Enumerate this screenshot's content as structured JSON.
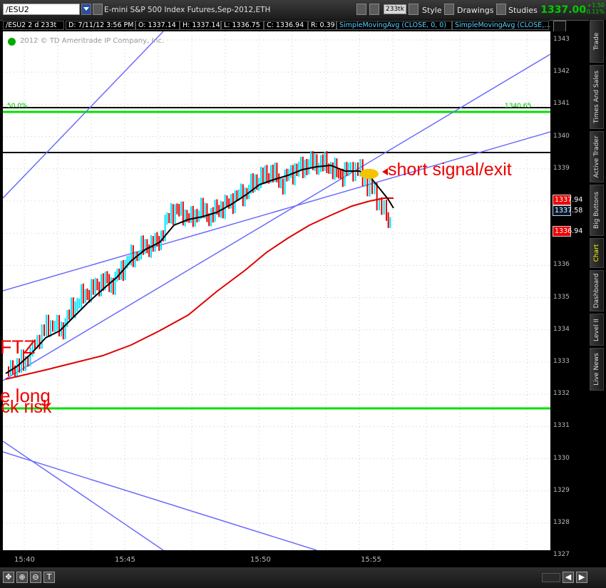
{
  "toolbar": {
    "symbol": "/ESU2",
    "description": "E-mini S&P 500 Index Futures,Sep-2012,ETH",
    "tick_badge": "233tk",
    "style_label": "Style",
    "drawings_label": "Drawings",
    "studies_label": "Studies",
    "last_price": "1337.00",
    "change_points": "+1.50",
    "change_percent": "+0.11%"
  },
  "infobar": {
    "symbol": "/ESU2 2 d 233t",
    "date": "D: 7/11/12 3:56 PM",
    "open": "O: 1337.14",
    "high": "H: 1337.14",
    "low": "L: 1336.75",
    "close": "C: 1336.94",
    "range": "R: 0.39",
    "sma1": "SimpleMovingAvg (CLOSE, 0, 0)",
    "sma2": "SimpleMovingAvg (CLOSE,..."
  },
  "chart": {
    "copyright": "2012 © TD Ameritrade IP Company, Inc.",
    "fib_left": "50.0%",
    "fib_right": "1340.65",
    "annotations": {
      "short_signal": "short signal/exit",
      "ftz": "FTZ",
      "long": "e long",
      "risk": "ick risk"
    },
    "y_ticks": [
      "1343",
      "1342",
      "1341",
      "1340",
      "1339",
      "1338",
      "1337",
      "1336",
      "1335",
      "1334",
      "1333",
      "1332",
      "1331",
      "1330",
      "1329",
      "1328",
      "1327"
    ],
    "x_ticks": [
      "15:40",
      "15:45",
      "15:50",
      "15:55"
    ],
    "price_tags": {
      "sma_red": "1337.94",
      "sma_black": "1337.58",
      "last": "1336.94"
    },
    "colors": {
      "bull": "#00e5ff",
      "bear": "#e00000",
      "trendline": "#6b6bff",
      "green_line": "#00e000",
      "black_line": "#000000"
    }
  },
  "side_tabs": [
    "Trade",
    "Times And Sales",
    "Active Trader",
    "Big Buttons",
    "Chart",
    "Dashboard",
    "Level II",
    "Live News"
  ],
  "active_tab": "Chart"
}
